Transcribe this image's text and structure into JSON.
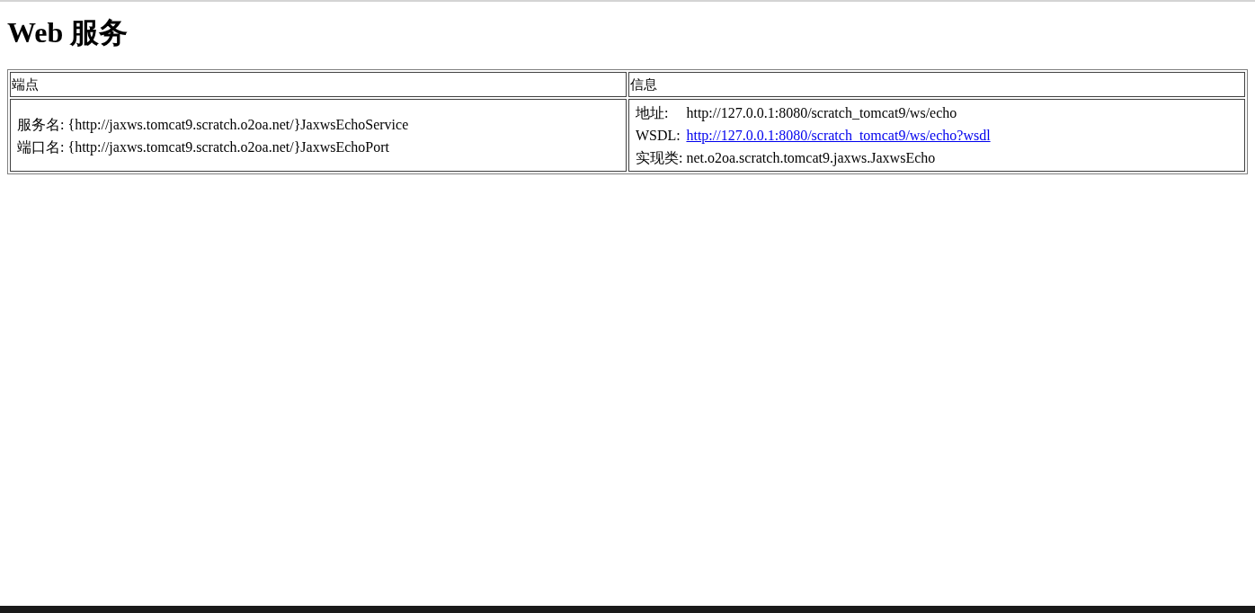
{
  "title": "Web 服务",
  "table": {
    "columns": [
      "端点",
      "信息"
    ],
    "rows": [
      {
        "endpoint": [
          {
            "label": "服务名:",
            "value": "{http://jaxws.tomcat9.scratch.o2oa.net/}JaxwsEchoService"
          },
          {
            "label": "端口名:",
            "value": "{http://jaxws.tomcat9.scratch.o2oa.net/}JaxwsEchoPort"
          }
        ],
        "info": [
          {
            "label": "地址:",
            "value": "http://127.0.0.1:8080/scratch_tomcat9/ws/echo",
            "kind": "text"
          },
          {
            "label": "WSDL:",
            "value": "http://127.0.0.1:8080/scratch_tomcat9/ws/echo?wsdl",
            "kind": "link"
          },
          {
            "label": "实现类:",
            "value": "net.o2oa.scratch.tomcat9.jaxws.JaxwsEcho",
            "kind": "text"
          }
        ]
      }
    ]
  }
}
